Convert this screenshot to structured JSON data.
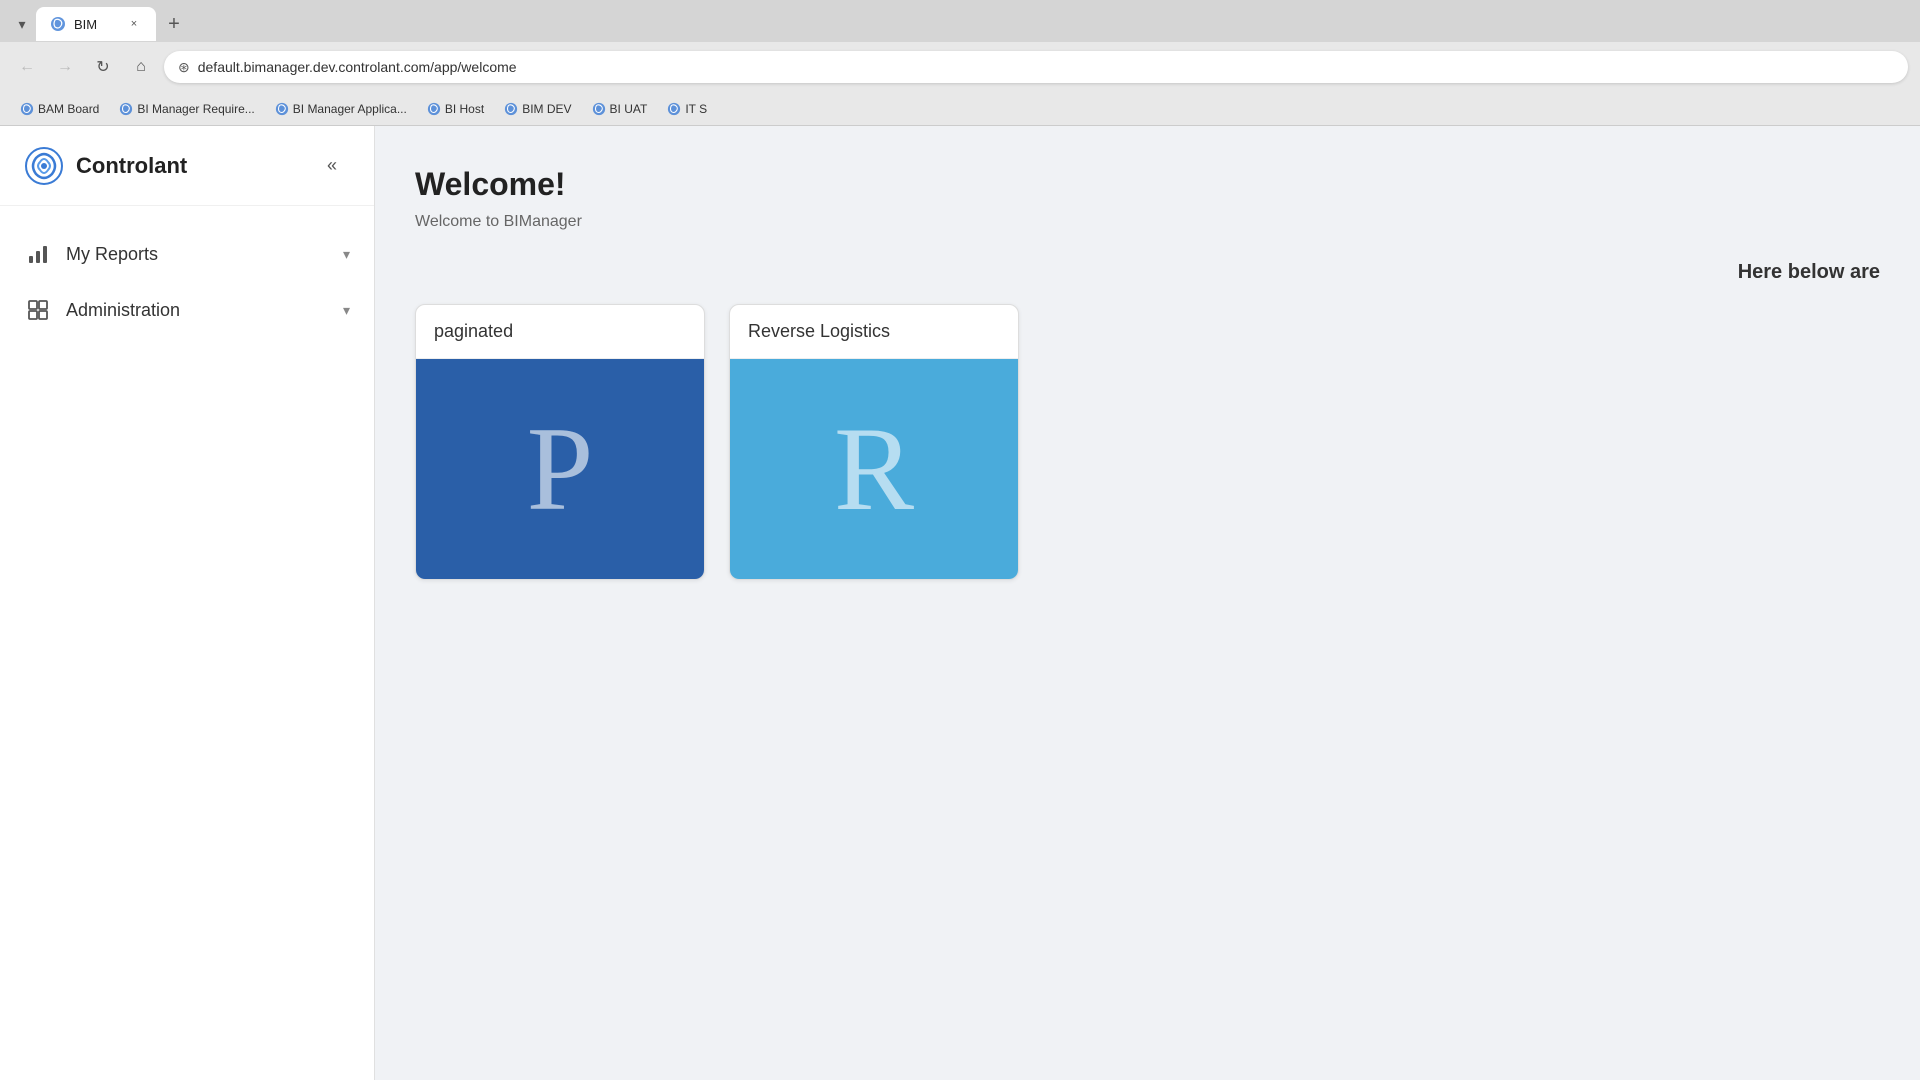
{
  "browser": {
    "tab": {
      "title": "BIM",
      "close_label": "×",
      "new_tab_label": "+"
    },
    "address": {
      "url": "default.bimanager.dev.controlant.com/app/welcome",
      "secure_icon": "🔒"
    },
    "nav": {
      "back_icon": "←",
      "forward_icon": "→",
      "reload_icon": "↻",
      "home_icon": "⌂"
    },
    "bookmarks": [
      {
        "label": "BAM Board"
      },
      {
        "label": "BI Manager Require..."
      },
      {
        "label": "BI Manager Applica..."
      },
      {
        "label": "BI Host"
      },
      {
        "label": "BIM DEV"
      },
      {
        "label": "BI UAT"
      },
      {
        "label": "IT S"
      }
    ]
  },
  "sidebar": {
    "logo_text": "Controlant",
    "collapse_icon": "«",
    "nav_items": [
      {
        "label": "My Reports",
        "icon": "chart"
      },
      {
        "label": "Administration",
        "icon": "grid"
      }
    ]
  },
  "main": {
    "welcome_title": "Welcome!",
    "welcome_subtitle": "Welcome to BIManager",
    "here_below": "Here below are",
    "cards": [
      {
        "title": "paginated",
        "letter": "P",
        "color": "blue-dark"
      },
      {
        "title": "Reverse Logistics",
        "letter": "R",
        "color": "blue-light"
      }
    ]
  }
}
